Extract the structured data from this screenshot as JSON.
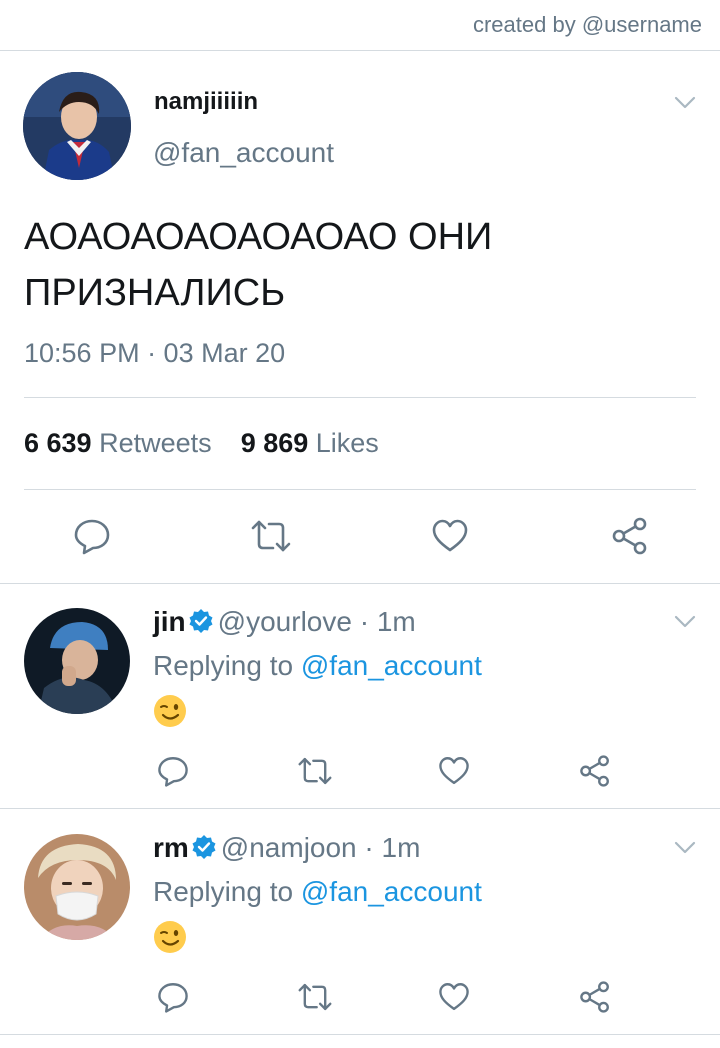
{
  "header": {
    "credit": "created by @username"
  },
  "main_tweet": {
    "display_name": "namjiiiiin",
    "handle": "@fan_account",
    "text_line1": "АОАОАОАОАОАОАО ОНИ",
    "text_line2": "ПРИЗНАЛИСЬ",
    "timestamp": "10:56 PM · 03 Mar 20",
    "retweets_count": "6 639",
    "retweets_label": "Retweets",
    "likes_count": "9 869",
    "likes_label": "Likes"
  },
  "replies": [
    {
      "name": "jin",
      "handle": "@yourlove",
      "time": "· 1m",
      "replying_prefix": "Replying to",
      "replying_handle": "@fan_account",
      "emoji": "wink-face"
    },
    {
      "name": "rm",
      "handle": "@namjoon",
      "time": "· 1m",
      "replying_prefix": "Replying to",
      "replying_handle": "@fan_account",
      "emoji": "wink-face"
    }
  ],
  "icons": [
    "reply-icon",
    "retweet-icon",
    "like-icon",
    "share-icon",
    "chevron-down-icon",
    "verified-badge-icon"
  ],
  "colors": {
    "accent": "#1b95e0",
    "text": "#14171a",
    "secondary": "#657786",
    "divider": "#d5dbe0"
  }
}
